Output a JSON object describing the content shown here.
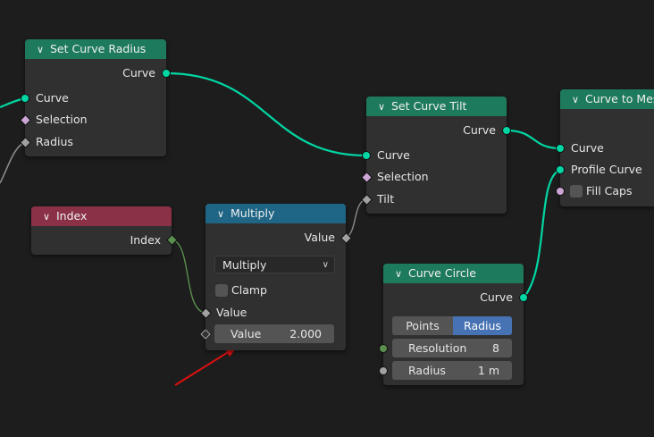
{
  "nodes": {
    "set_curve_radius": {
      "title": "Set Curve Radius",
      "output": "Curve",
      "inputs": [
        "Curve",
        "Selection",
        "Radius"
      ]
    },
    "set_curve_tilt": {
      "title": "Set Curve Tilt",
      "output": "Curve",
      "inputs": [
        "Curve",
        "Selection",
        "Tilt"
      ]
    },
    "curve_to_mesh": {
      "title": "Curve to Mesh",
      "inputs": [
        "Curve",
        "Profile Curve"
      ],
      "fill_caps_label": "Fill Caps"
    },
    "index": {
      "title": "Index",
      "output": "Index"
    },
    "multiply": {
      "title": "Multiply",
      "output": "Value",
      "operation": "Multiply",
      "clamp_label": "Clamp",
      "input_value_label": "Value",
      "field_label": "Value",
      "field_value": "2.000"
    },
    "curve_circle": {
      "title": "Curve Circle",
      "output": "Curve",
      "mode_points": "Points",
      "mode_radius": "Radius",
      "resolution_label": "Resolution",
      "resolution_value": "8",
      "radius_label": "Radius",
      "radius_value": "1 m"
    }
  },
  "colors": {
    "background": "#1d1d1d",
    "geometry_header": "#1e7a5c",
    "input_header": "#8a3047",
    "converter_header": "#1f6585",
    "curve_socket": "#00d6a3",
    "active_toggle": "#4772b3",
    "annotation_arrow": "#e01010"
  },
  "icons": {
    "collapse": "chevron-down-icon"
  }
}
